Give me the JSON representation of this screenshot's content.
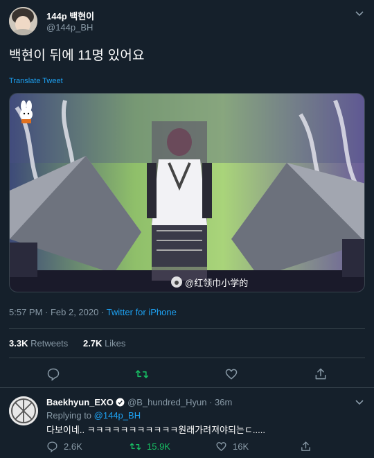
{
  "tweet": {
    "display_name": "144p 백현이",
    "handle": "@144p_BH",
    "text": "백현이 뒤에 11명 있어요",
    "translate_label": "Translate Tweet",
    "media_watermark": "@红领巾小学的",
    "time_date": "5:57 PM · Feb 2, 2020 · ",
    "source": "Twitter for iPhone",
    "retweets_count": "3.3K",
    "retweets_label": "Retweets",
    "likes_count": "2.7K",
    "likes_label": "Likes"
  },
  "reply": {
    "display_name": "Baekhyun_EXO",
    "handle": "@B_hundred_Hyun",
    "time": "· 36m",
    "replying_prefix": "Replying to",
    "replying_handle": "@144p_BH",
    "text": "다보이네.. ㅋㅋㅋㅋㅋㅋㅋㅋㅋㅋㅋ원래가려져야되는ㄷ.....",
    "reply_count": "2.6K",
    "retweet_count": "15.9K",
    "like_count": "16K"
  },
  "colors": {
    "background": "#15202b",
    "accent": "#1da1f2",
    "retweet_green": "#17bf63",
    "muted": "#8899a6",
    "divider": "#38444d"
  },
  "icons": [
    "caret-down-icon",
    "reply-icon",
    "retweet-icon",
    "like-icon",
    "share-icon",
    "verified-icon"
  ]
}
